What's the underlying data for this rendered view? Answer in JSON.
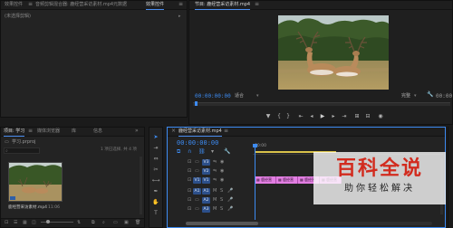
{
  "colors": {
    "accent": "#3d8bf2",
    "clip": "#e27ee2",
    "watermark_red": "#d22b1e",
    "playhead": "#3d8bf2"
  },
  "source_panel": {
    "tabs": [
      "效果控件",
      "音频剪辑混合器: 鹿经营采访素材.mp4",
      "元数据",
      "效果控件"
    ],
    "active_tab_index": 3,
    "message": "(未选择剪辑)"
  },
  "program_panel": {
    "title": "节目: 鹿经营采访素材.mp4",
    "timecode": "00:00:00:00",
    "zoom": "适合",
    "resolution": "完整",
    "controls": [
      "marker-icon",
      "in-point-icon",
      "out-point-icon",
      "go-to-in-icon",
      "step-back-icon",
      "play-icon",
      "step-forward-icon",
      "go-to-out-icon",
      "insert-icon",
      "overwrite-icon",
      "export-frame-icon"
    ]
  },
  "project_panel": {
    "tabs": [
      "项目: 学习",
      "媒体浏览器",
      "库",
      "信息"
    ],
    "active_tab_index": 0,
    "project_file": "学习.prproj",
    "selection_info": "1 项已选择, 共 4 项",
    "item_name": "鹿经营采访素材.mp4",
    "item_duration": "11:06"
  },
  "tools": [
    "selection-icon",
    "track-select-icon",
    "ripple-edit-icon",
    "razor-icon",
    "slip-icon",
    "pen-icon",
    "hand-icon",
    "type-icon"
  ],
  "timeline": {
    "title": "鹿经营采访素材.mp4",
    "timecode": "00:00:00:00",
    "ruler_start": "00:00",
    "tracks": [
      {
        "name": "V3",
        "kind": "video"
      },
      {
        "name": "V2",
        "kind": "video"
      },
      {
        "name": "V1",
        "kind": "video"
      },
      {
        "name": "A1",
        "kind": "audio"
      },
      {
        "name": "A2",
        "kind": "audio"
      },
      {
        "name": "A3",
        "kind": "audio"
      }
    ],
    "clips": [
      {
        "label": "鹿经营",
        "track": "V1"
      },
      {
        "label": "鹿经营",
        "track": "V1"
      },
      {
        "label": "鹿经营",
        "track": "V1"
      },
      {
        "label": "鹿经营",
        "track": "V1"
      }
    ]
  },
  "watermark": {
    "title": "百科全说",
    "subtitle": "助你轻松解决"
  }
}
